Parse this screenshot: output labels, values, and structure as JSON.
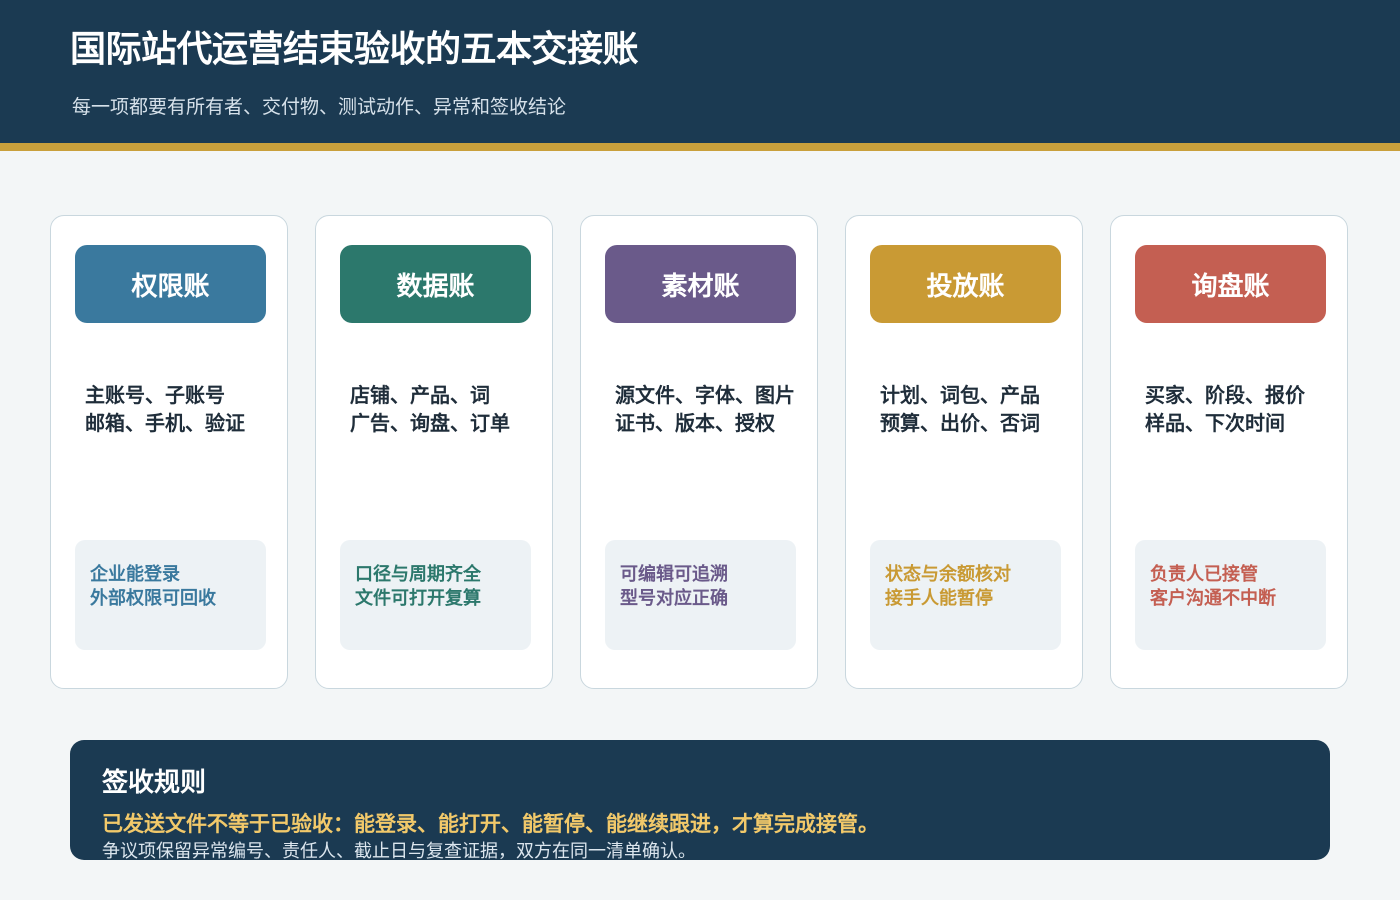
{
  "header": {
    "title": "国际站代运营结束验收的五本交接账",
    "subtitle": "每一项都要有所有者、交付物、测试动作、异常和签收结论"
  },
  "cards": [
    {
      "title": "权限账",
      "items": [
        "主账号、子账号",
        "邮箱、手机、验证"
      ],
      "note": [
        "企业能登录",
        "外部权限可回收"
      ],
      "color": "#3a799e"
    },
    {
      "title": "数据账",
      "items": [
        "店铺、产品、词",
        "广告、询盘、订单"
      ],
      "note": [
        "口径与周期齐全",
        "文件可打开复算"
      ],
      "color": "#2c786c"
    },
    {
      "title": "素材账",
      "items": [
        "源文件、字体、图片",
        "证书、版本、授权"
      ],
      "note": [
        "可编辑可追溯",
        "型号对应正确"
      ],
      "color": "#6a5a8a"
    },
    {
      "title": "投放账",
      "items": [
        "计划、词包、产品",
        "预算、出价、否词"
      ],
      "note": [
        "状态与余额核对",
        "接手人能暂停"
      ],
      "color": "#c99a34"
    },
    {
      "title": "询盘账",
      "items": [
        "买家、阶段、报价",
        "样品、下次时间"
      ],
      "note": [
        "负责人已接管",
        "客户沟通不中断"
      ],
      "color": "#c45f52"
    }
  ],
  "rule": {
    "title": "签收规则",
    "main": "已发送文件不等于已验收：能登录、能打开、能暂停、能继续跟进，才算完成接管。",
    "sub": "争议项保留异常编号、责任人、截止日与复查证据，双方在同一清单确认。"
  }
}
